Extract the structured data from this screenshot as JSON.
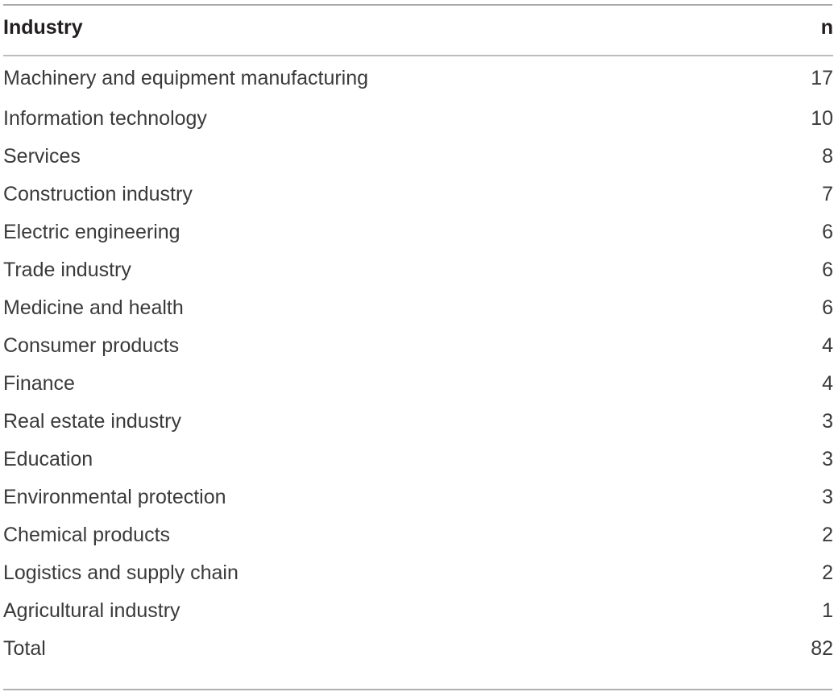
{
  "table": {
    "columns": {
      "industry_header": "Industry",
      "n_header": "n"
    },
    "rows": [
      {
        "industry": "Machinery and equipment manufacturing",
        "n": "17"
      },
      {
        "industry": "Information technology",
        "n": "10"
      },
      {
        "industry": "Services",
        "n": "8"
      },
      {
        "industry": "Construction industry",
        "n": "7"
      },
      {
        "industry": "Electric engineering",
        "n": "6"
      },
      {
        "industry": "Trade industry",
        "n": "6"
      },
      {
        "industry": "Medicine and health",
        "n": "6"
      },
      {
        "industry": "Consumer products",
        "n": "4"
      },
      {
        "industry": "Finance",
        "n": "4"
      },
      {
        "industry": "Real estate industry",
        "n": "3"
      },
      {
        "industry": "Education",
        "n": "3"
      },
      {
        "industry": "Environmental protection",
        "n": "3"
      },
      {
        "industry": "Chemical products",
        "n": "2"
      },
      {
        "industry": "Logistics and supply chain",
        "n": "2"
      },
      {
        "industry": "Agricultural industry",
        "n": "1"
      },
      {
        "industry": "Total",
        "n": "82"
      }
    ]
  },
  "chart_data": {
    "type": "table",
    "title": "",
    "columns": [
      "Industry",
      "n"
    ],
    "categories": [
      "Machinery and equipment manufacturing",
      "Information technology",
      "Services",
      "Construction industry",
      "Electric engineering",
      "Trade industry",
      "Medicine and health",
      "Consumer products",
      "Finance",
      "Real estate industry",
      "Education",
      "Environmental protection",
      "Chemical products",
      "Logistics and supply chain",
      "Agricultural industry"
    ],
    "values": [
      17,
      10,
      8,
      7,
      6,
      6,
      6,
      4,
      4,
      3,
      3,
      3,
      2,
      2,
      1
    ],
    "total": 82,
    "xlabel": "Industry",
    "ylabel": "n"
  },
  "style": {
    "rule_color": "#b0b0b0",
    "header_text_color": "#231f20",
    "body_text_color": "#3a3a3a",
    "background": "#ffffff"
  }
}
